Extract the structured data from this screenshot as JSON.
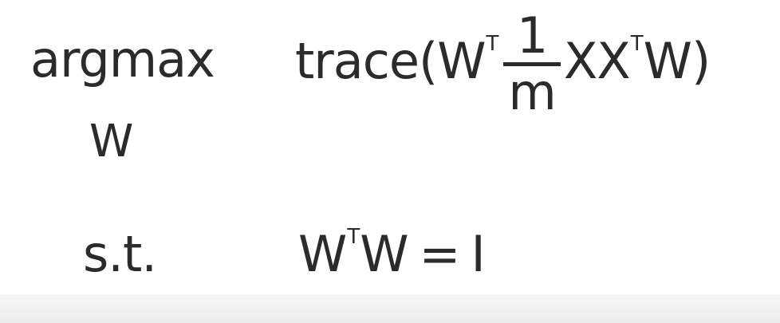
{
  "optimization": {
    "operator": "argmax",
    "operator_subscript": "W",
    "objective": {
      "prefix": "trace(W",
      "transpose_1": "T",
      "fraction_numerator": "1",
      "fraction_denominator": "m",
      "middle": "XX",
      "transpose_2": "T",
      "suffix": "W)"
    },
    "constraint_label": "s.t.",
    "constraint": {
      "left_base": "W",
      "left_transpose": "T",
      "left_tail": "W",
      "equals": "=",
      "right": "I"
    }
  }
}
